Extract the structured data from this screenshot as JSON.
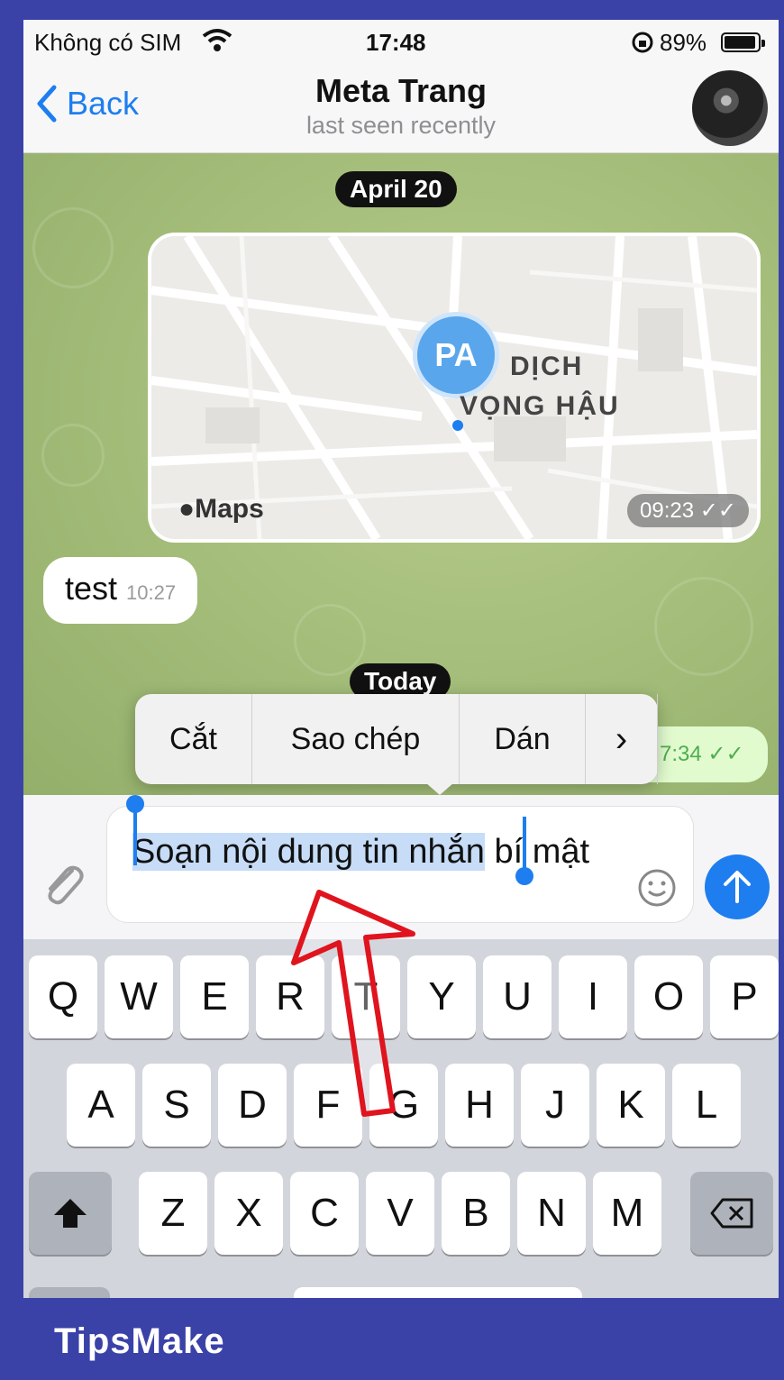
{
  "status_bar": {
    "carrier": "Không có SIM",
    "time": "17:48",
    "battery": "89%"
  },
  "nav": {
    "back_label": "Back",
    "title": "Meta Trang",
    "subtitle": "last seen recently"
  },
  "chat": {
    "date_pill_1": "April 20",
    "map_message": {
      "source_label": "Maps",
      "avatar_initials": "PA",
      "place_line_1": "DỊCH",
      "place_line_2": "VỌNG HẬU",
      "time": "09:23"
    },
    "incoming_message": {
      "text": "test",
      "time": "10:27"
    },
    "date_pill_2": "Today",
    "outgoing_message": {
      "time": "7:34"
    }
  },
  "context_menu": {
    "items": [
      "Cắt",
      "Sao chép",
      "Dán"
    ],
    "more_label": "›"
  },
  "composer": {
    "selected_text": "Soạn nội dung tin nhắn",
    "rest_text": " bí mật"
  },
  "keyboard": {
    "row1": [
      "Q",
      "W",
      "E",
      "R",
      "T",
      "Y",
      "U",
      "I",
      "O",
      "P"
    ],
    "row2": [
      "A",
      "S",
      "D",
      "F",
      "G",
      "H",
      "J",
      "K",
      "L"
    ],
    "row3": [
      "Z",
      "X",
      "C",
      "V",
      "B",
      "N",
      "M"
    ]
  },
  "overlay": {
    "watermark": "TipsMake",
    "brand": "TipsMake"
  },
  "colors": {
    "accent": "#1e7ef0",
    "frame": "#3a42a8",
    "arrow": "#e0141e"
  }
}
